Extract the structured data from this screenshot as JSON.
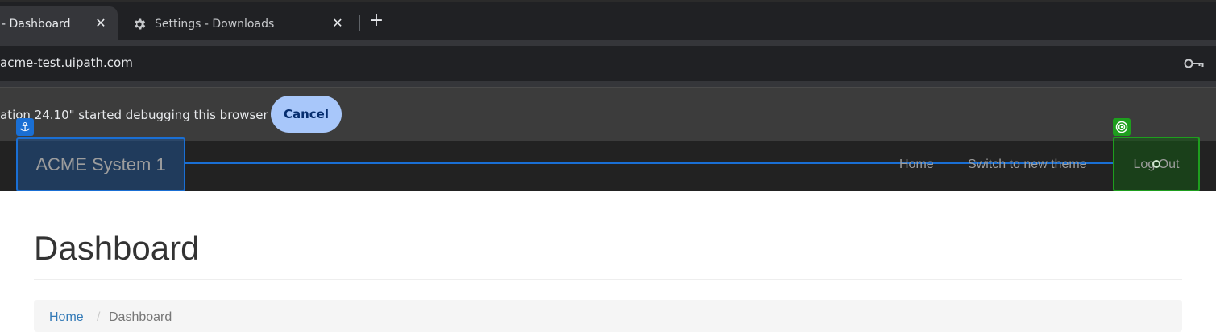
{
  "browser": {
    "tabs": [
      {
        "label": "- Dashboard",
        "close": "✕"
      },
      {
        "label": "Settings - Downloads",
        "close": "✕"
      }
    ],
    "new_tab": "+",
    "url": "acme-test.uipath.com",
    "infobar": {
      "message": "ation 24.10\" started debugging this browser",
      "cancel_label": "Cancel"
    }
  },
  "navbar": {
    "brand": "ACME System 1",
    "links": [
      "Home",
      "Switch to new theme"
    ],
    "logout": "Log Out"
  },
  "badges": {
    "anchor": "⚓"
  },
  "page": {
    "title": "Dashboard",
    "breadcrumb": {
      "home": "Home",
      "separator": "/",
      "current": "Dashboard"
    }
  },
  "colors": {
    "anchor_highlight": "#1a6fd4",
    "target_highlight": "#1e9e1e",
    "cancel_button": "#a8c7fa"
  }
}
